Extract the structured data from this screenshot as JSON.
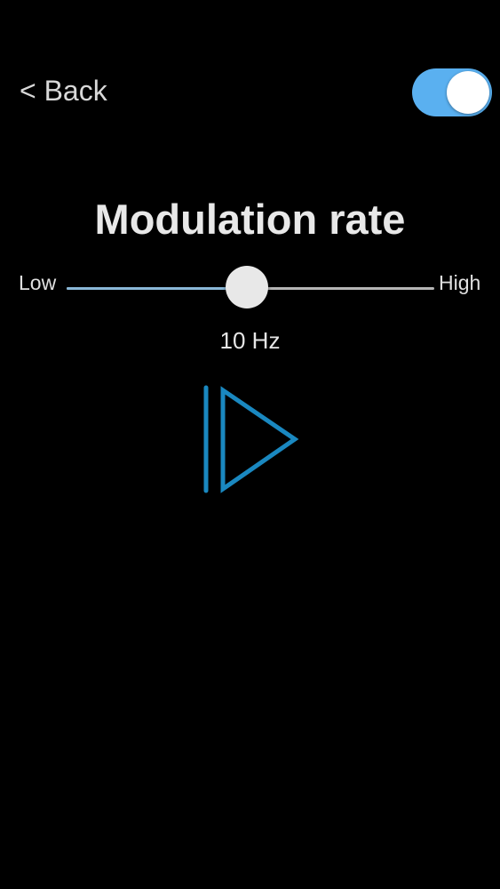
{
  "header": {
    "back_label": "< Back",
    "toggle_on": true
  },
  "main": {
    "title": "Modulation rate",
    "slider": {
      "min_label": "Low",
      "max_label": "High",
      "value_fraction": 0.49
    },
    "rate_value": "10 Hz",
    "play_icon": "play-icon"
  },
  "colors": {
    "background": "#000000",
    "accent": "#1a88c0",
    "toggle_on": "#5ab0f0"
  }
}
